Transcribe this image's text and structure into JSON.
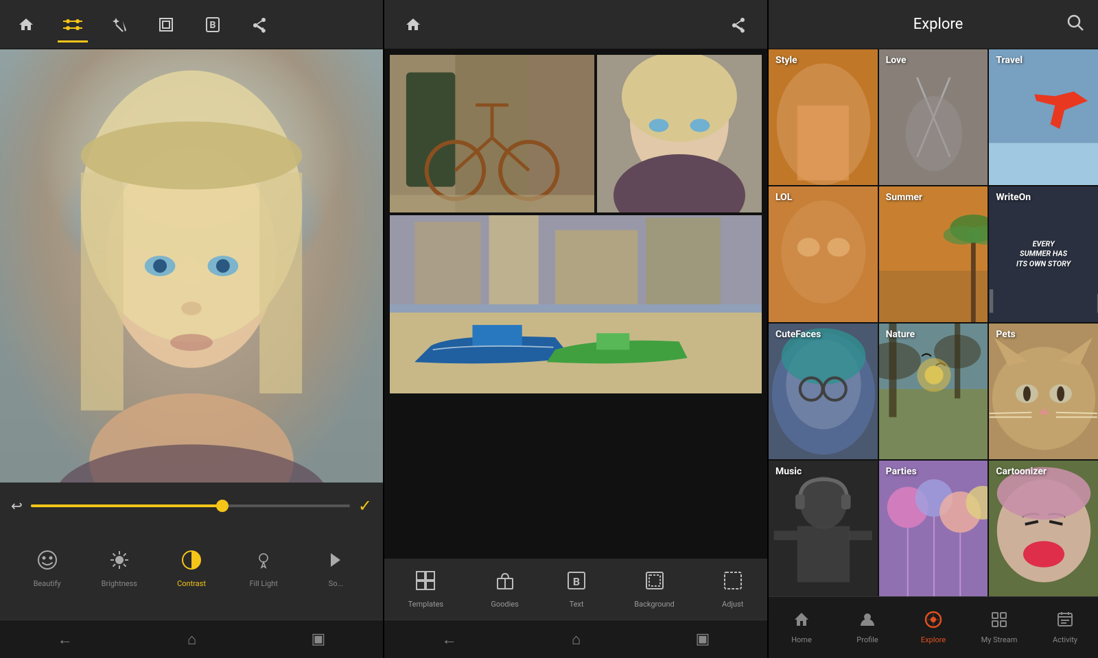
{
  "panel1": {
    "toolbar": {
      "icons": [
        "home",
        "sliders",
        "wand",
        "frame",
        "bold-b",
        "share"
      ]
    },
    "controls": {
      "slider_value": 60,
      "tools": [
        {
          "label": "Beautify",
          "icon": "smile",
          "active": false
        },
        {
          "label": "Brightness",
          "icon": "sun",
          "active": false
        },
        {
          "label": "Contrast",
          "icon": "contrast",
          "active": true
        },
        {
          "label": "Fill Light",
          "icon": "bulb",
          "active": false
        },
        {
          "label": "So...",
          "icon": "other",
          "active": false
        }
      ]
    },
    "nav": [
      "back",
      "home",
      "recents"
    ]
  },
  "panel2": {
    "toolbar": {
      "left_icon": "home",
      "right_icon": "share"
    },
    "bottom_tools": [
      {
        "label": "Templates",
        "icon": "templates"
      },
      {
        "label": "Goodies",
        "icon": "goodies"
      },
      {
        "label": "Text",
        "icon": "text-b"
      },
      {
        "label": "Background",
        "icon": "background"
      },
      {
        "label": "Adjust",
        "icon": "adjust"
      }
    ],
    "nav": [
      "back",
      "home",
      "recents"
    ]
  },
  "panel3": {
    "header": {
      "title": "Explore",
      "search_icon": "search"
    },
    "grid": [
      {
        "label": "Style",
        "bg": "style"
      },
      {
        "label": "Love",
        "bg": "love"
      },
      {
        "label": "Travel",
        "bg": "travel"
      },
      {
        "label": "LOL",
        "bg": "lol"
      },
      {
        "label": "Summer",
        "bg": "summer"
      },
      {
        "label": "WriteOn",
        "bg": "writeon",
        "subtitle": "EVERY SUMMER HAS ITS OWN STORY"
      },
      {
        "label": "CuteFaces",
        "bg": "cutefaces"
      },
      {
        "label": "Nature",
        "bg": "nature"
      },
      {
        "label": "Pets",
        "bg": "pets"
      },
      {
        "label": "Music",
        "bg": "music"
      },
      {
        "label": "Parties",
        "bg": "parties"
      },
      {
        "label": "Cartoonizer",
        "bg": "cartoonizer"
      }
    ],
    "nav": [
      {
        "label": "Home",
        "icon": "home",
        "active": false
      },
      {
        "label": "Profile",
        "icon": "profile",
        "active": false
      },
      {
        "label": "Explore",
        "icon": "explore",
        "active": true
      },
      {
        "label": "My Stream",
        "icon": "stream",
        "active": false
      },
      {
        "label": "Activity",
        "icon": "activity",
        "active": false
      }
    ]
  }
}
